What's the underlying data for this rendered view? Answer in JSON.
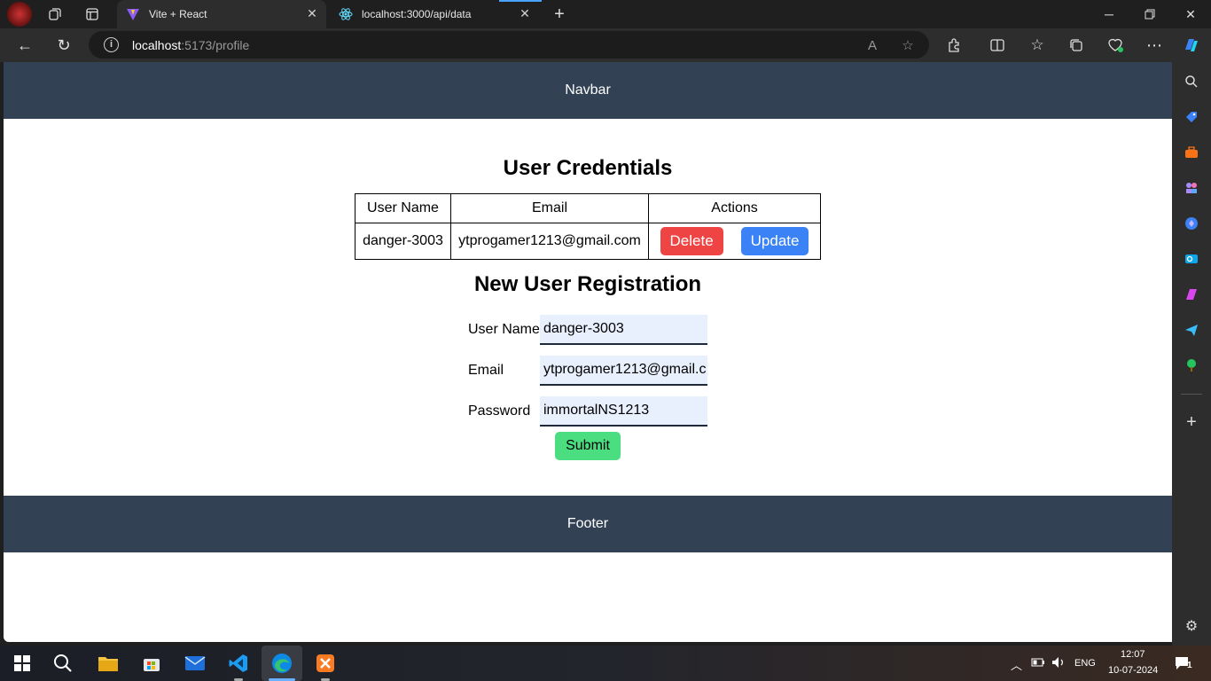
{
  "browser": {
    "tabs": [
      {
        "title": "Vite + React",
        "active": true
      },
      {
        "title": "localhost:3000/api/data",
        "active": false
      }
    ],
    "address": {
      "host": "localhost",
      "path": ":5173/profile"
    }
  },
  "page": {
    "navbar_text": "Navbar",
    "credentials_title": "User Credentials",
    "table": {
      "headers": [
        "User Name",
        "Email",
        "Actions"
      ],
      "rows": [
        {
          "username": "danger-3003",
          "email": "ytprogamer1213@gmail.com"
        }
      ],
      "delete_label": "Delete",
      "update_label": "Update"
    },
    "registration_title": "New User Registration",
    "form": {
      "username_label": "User Name",
      "username_value": "danger-3003",
      "email_label": "Email",
      "email_value": "ytprogamer1213@gmail.c",
      "password_label": "Password",
      "password_value": "immortalNS1213",
      "submit_label": "Submit"
    },
    "footer_text": "Footer"
  },
  "taskbar": {
    "language": "ENG",
    "time": "12:07",
    "date": "10-07-2024",
    "notification_count": "1"
  },
  "colors": {
    "navbar_bg": "#334155",
    "delete": "#ef4444",
    "update": "#3b82f6",
    "submit": "#4ade80"
  }
}
